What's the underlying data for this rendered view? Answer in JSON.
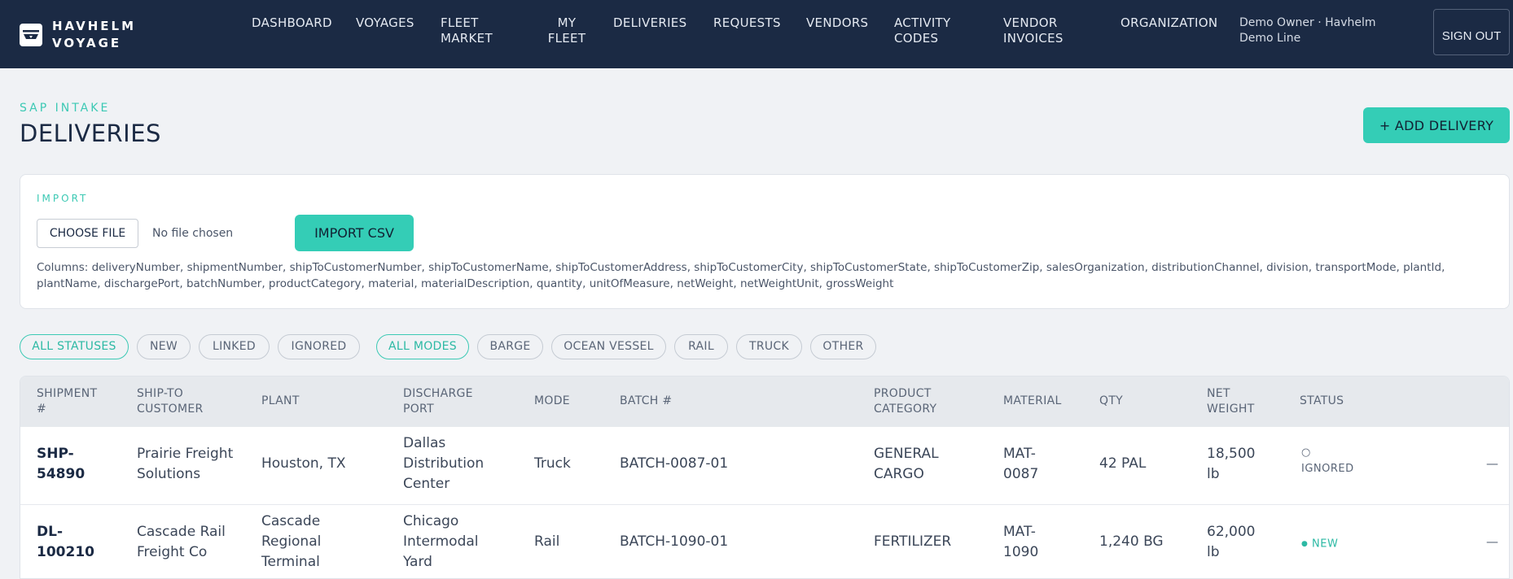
{
  "app": {
    "brand": "HAVHELM VOYAGE"
  },
  "nav": {
    "items": [
      {
        "label": "DASHBOARD"
      },
      {
        "label": "VOYAGES"
      },
      {
        "label": "FLEET MARKET"
      },
      {
        "label": "MY FLEET"
      },
      {
        "label": "DELIVERIES"
      },
      {
        "label": "REQUESTS"
      },
      {
        "label": "VENDORS"
      },
      {
        "label": "ACTIVITY CODES"
      },
      {
        "label": "VENDOR INVOICES"
      },
      {
        "label": "ORGANIZATION"
      }
    ],
    "user": "Demo Owner · Havhelm Demo Line",
    "signout": "SIGN OUT"
  },
  "page": {
    "eyebrow": "SAP INTAKE",
    "title": "DELIVERIES",
    "add_button": "+ ADD DELIVERY"
  },
  "import": {
    "label": "IMPORT",
    "choose_file": "CHOOSE FILE",
    "no_file": "No file chosen",
    "button": "IMPORT CSV",
    "columns": "Columns: deliveryNumber, shipmentNumber, shipToCustomerNumber, shipToCustomerName, shipToCustomerAddress, shipToCustomerCity, shipToCustomerState, shipToCustomerZip, salesOrganization, distributionChannel, division, transportMode, plantId, plantName, dischargePort, batchNumber, productCategory, material, materialDescription, quantity, unitOfMeasure, netWeight, netWeightUnit, grossWeight"
  },
  "filters": {
    "status": [
      {
        "label": "ALL STATUSES",
        "active": true
      },
      {
        "label": "NEW",
        "active": false
      },
      {
        "label": "LINKED",
        "active": false
      },
      {
        "label": "IGNORED",
        "active": false
      }
    ],
    "mode": [
      {
        "label": "ALL MODES",
        "active": true
      },
      {
        "label": "BARGE",
        "active": false
      },
      {
        "label": "OCEAN VESSEL",
        "active": false
      },
      {
        "label": "RAIL",
        "active": false
      },
      {
        "label": "TRUCK",
        "active": false
      },
      {
        "label": "OTHER",
        "active": false
      }
    ]
  },
  "table": {
    "columns": [
      "SHIPMENT #",
      "SHIP-TO CUSTOMER",
      "PLANT",
      "DISCHARGE PORT",
      "MODE",
      "BATCH #",
      "PRODUCT CATEGORY",
      "MATERIAL",
      "QTY",
      "NET WEIGHT",
      "STATUS"
    ],
    "rows": [
      {
        "shipment": "SHP-54890",
        "customer": "Prairie Freight Solutions",
        "plant": "Houston, TX",
        "port": "Dallas Distribution Center",
        "mode": "Truck",
        "batch": "BATCH-0087-01",
        "category": "GENERAL CARGO",
        "material": "MAT-0087",
        "qty": "42 PAL",
        "net_weight": "18,500 lb",
        "status_icon": "○",
        "status": "IGNORED",
        "action": "—"
      },
      {
        "shipment": "DL-100210",
        "customer": "Cascade Rail Freight Co",
        "plant": "Cascade Regional Terminal",
        "port": "Chicago Intermodal Yard",
        "mode": "Rail",
        "batch": "BATCH-1090-01",
        "category": "FERTILIZER",
        "material": "MAT-1090",
        "qty": "1,240 BG",
        "net_weight": "62,000 lb",
        "status_icon": "●",
        "status": "NEW",
        "action": "—"
      }
    ]
  },
  "colors": {
    "navy": "#1b2a44",
    "accent": "#34cdb6",
    "background": "#f0f2f5"
  }
}
